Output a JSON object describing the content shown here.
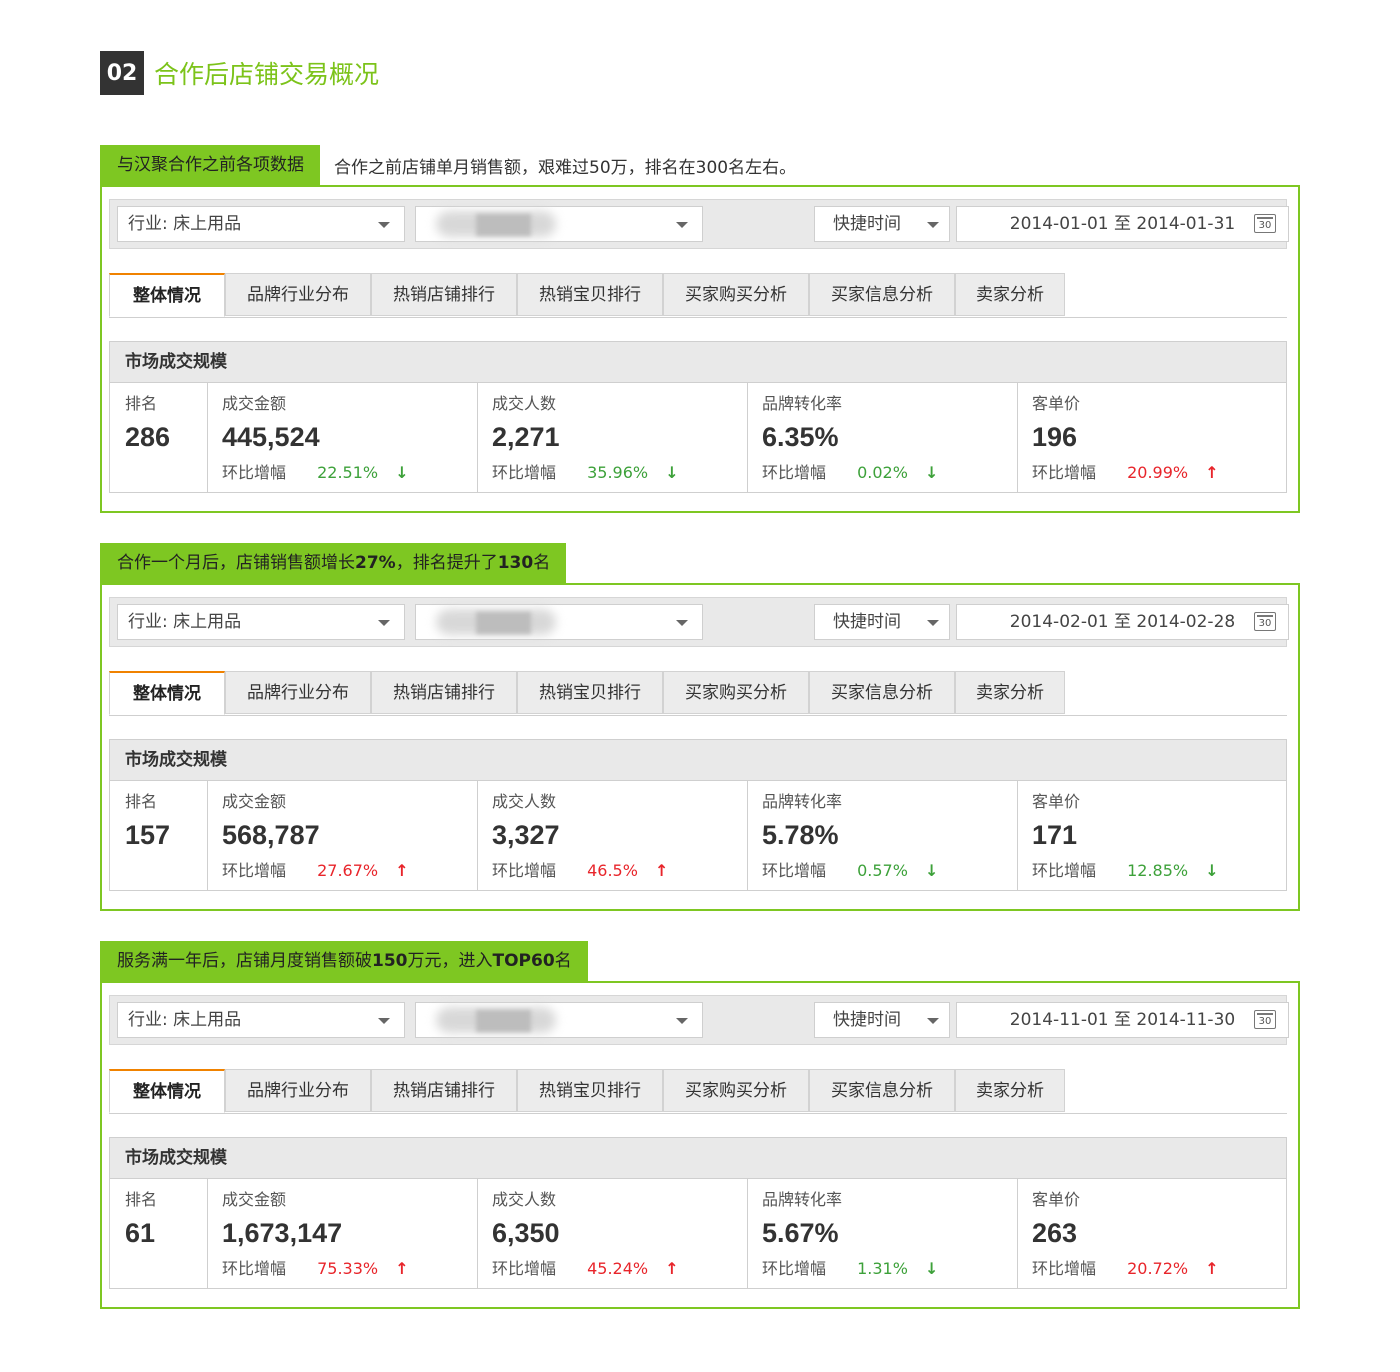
{
  "section": {
    "number": "02",
    "title": "合作后店铺交易概况"
  },
  "ui": {
    "industry_label": "行业: 床上用品",
    "quick_time_label": "快捷时间",
    "date_sep": "至",
    "calendar_text": "30",
    "tabs": [
      "整体情况",
      "品牌行业分布",
      "热销店铺排行",
      "热销宝贝排行",
      "买家购买分析",
      "买家信息分析",
      "卖家分析"
    ],
    "market_title": "市场成交规模",
    "labels": {
      "rank": "排名",
      "amount": "成交金额",
      "buyers": "成交人数",
      "conversion": "品牌转化率",
      "unit_price": "客单价",
      "change": "环比增幅"
    }
  },
  "panels": [
    {
      "tag": "与汉聚合作之前各项数据",
      "note": "合作之前店铺单月销售额，艰难过50万，排名在300名左右。",
      "date_from": "2014-01-01",
      "date_to": "2014-01-31",
      "rank": "286",
      "amount": {
        "value": "445,524",
        "change": "22.51%",
        "dir": "down"
      },
      "buyers": {
        "value": "2,271",
        "change": "35.96%",
        "dir": "down"
      },
      "conversion": {
        "value": "6.35%",
        "change": "0.02%",
        "dir": "down"
      },
      "unit_price": {
        "value": "196",
        "change": "20.99%",
        "dir": "up"
      }
    },
    {
      "tag_parts": [
        "合作一个月后，店铺销售额增长",
        "27%",
        "，排名提升了",
        "130",
        "名"
      ],
      "note": "",
      "date_from": "2014-02-01",
      "date_to": "2014-02-28",
      "rank": "157",
      "amount": {
        "value": "568,787",
        "change": "27.67%",
        "dir": "up"
      },
      "buyers": {
        "value": "3,327",
        "change": "46.5%",
        "dir": "up"
      },
      "conversion": {
        "value": "5.78%",
        "change": "0.57%",
        "dir": "down"
      },
      "unit_price": {
        "value": "171",
        "change": "12.85%",
        "dir": "down"
      }
    },
    {
      "tag_parts": [
        "服务满一年后，店铺月度销售额破",
        "150",
        "万元，进入",
        "TOP60",
        "名"
      ],
      "note": "",
      "date_from": "2014-11-01",
      "date_to": "2014-11-30",
      "rank": "61",
      "amount": {
        "value": "1,673,147",
        "change": "75.33%",
        "dir": "up"
      },
      "buyers": {
        "value": "6,350",
        "change": "45.24%",
        "dir": "up"
      },
      "conversion": {
        "value": "5.67%",
        "change": "1.31%",
        "dir": "down"
      },
      "unit_price": {
        "value": "263",
        "change": "20.72%",
        "dir": "up"
      }
    }
  ],
  "colors": {
    "accent_green": "#7ec722",
    "up_red": "#e8252b",
    "down_green": "#3da13a",
    "tab_active": "#f08200"
  }
}
